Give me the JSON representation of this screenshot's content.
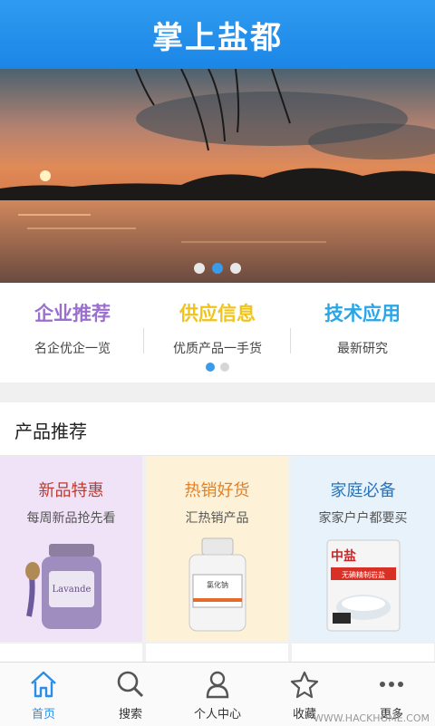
{
  "header": {
    "title": "掌上盐都"
  },
  "banner": {
    "slides": 3,
    "active_slide": 2
  },
  "categories": [
    {
      "title": "企业推荐",
      "subtitle": "名企优企一览",
      "color": "#9b6fd0"
    },
    {
      "title": "供应信息",
      "subtitle": "优质产品一手货",
      "color": "#f0c419"
    },
    {
      "title": "技术应用",
      "subtitle": "最新研究",
      "color": "#2aa6e6"
    }
  ],
  "section": {
    "title": "产品推荐"
  },
  "products": [
    {
      "title": "新品特惠",
      "desc": "每周新品抢先看",
      "title_color": "#c0392b",
      "bg": "#f0e3f8"
    },
    {
      "title": "热销好货",
      "desc": "汇热销产品",
      "title_color": "#e67e22",
      "bg": "#fdf2d8"
    },
    {
      "title": "家庭必备",
      "desc": "家家户户都要买",
      "title_color": "#2b74b8",
      "bg": "#e7f2fb"
    }
  ],
  "product_labels": {
    "salt_brand": "中盐",
    "salt_name": "无碘精制岩盐",
    "jar_label": "Lavande",
    "bottle_label": "氯化钠"
  },
  "tabs": [
    {
      "label": "首页",
      "icon": "home-icon"
    },
    {
      "label": "搜索",
      "icon": "search-icon"
    },
    {
      "label": "个人中心",
      "icon": "person-icon"
    },
    {
      "label": "收藏",
      "icon": "favorite-icon"
    },
    {
      "label": "更多",
      "icon": "more-icon"
    }
  ],
  "watermark": "WWW.HACKHOME.COM"
}
